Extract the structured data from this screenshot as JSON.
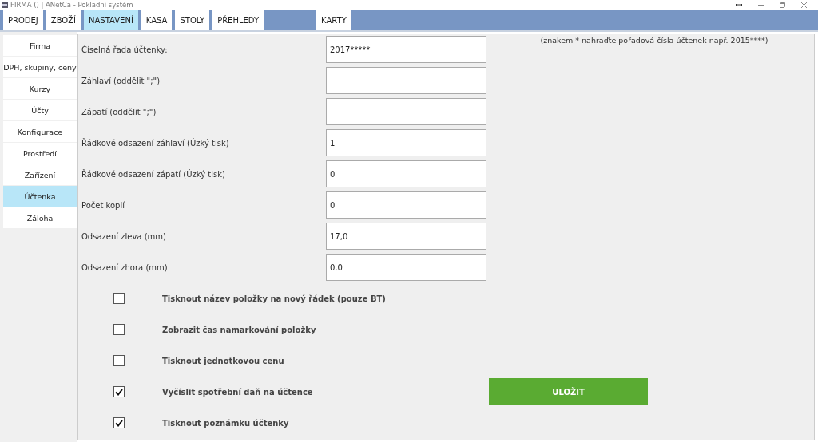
{
  "window": {
    "title": "FIRMA () | ANetCa - Pokladní systém"
  },
  "tabs": [
    {
      "label": "PRODEJ",
      "selected": false
    },
    {
      "label": "ZBOŽÍ",
      "selected": false
    },
    {
      "label": "NASTAVENÍ",
      "selected": true
    },
    {
      "label": "KASA",
      "selected": false
    },
    {
      "label": "STOLY",
      "selected": false
    },
    {
      "label": "PŘEHLEDY",
      "selected": false
    },
    {
      "label": "KARTY",
      "selected": false
    }
  ],
  "sidebar": {
    "items": [
      {
        "label": "Firma",
        "selected": false
      },
      {
        "label": "DPH, skupiny, ceny",
        "selected": false
      },
      {
        "label": "Kurzy",
        "selected": false
      },
      {
        "label": "Účty",
        "selected": false
      },
      {
        "label": "Konfigurace",
        "selected": false
      },
      {
        "label": "Prostředí",
        "selected": false
      },
      {
        "label": "Zařízení",
        "selected": false
      },
      {
        "label": "Účtenka",
        "selected": true
      },
      {
        "label": "Záloha",
        "selected": false
      }
    ]
  },
  "note": "(znakem * nahraďte pořadová čísla účtenek např. 2015****)",
  "fields": [
    {
      "label": "Číselná řada účtenky:",
      "value": "2017*****"
    },
    {
      "label": "Záhlaví (oddělit \";\")"
    },
    {
      "label": "Zápatí (oddělit \";\")"
    },
    {
      "label": "Řádkové odsazení záhlaví (Úzký tisk)",
      "value": "1"
    },
    {
      "label": "Řádkové odsazení zápatí (Úzký tisk)",
      "value": "0"
    },
    {
      "label": "Počet kopií",
      "value": "0"
    },
    {
      "label": "Odsazení zleva (mm)",
      "value": "17,0"
    },
    {
      "label": "Odsazení zhora (mm)",
      "value": "0,0"
    }
  ],
  "options": [
    {
      "label": "Tisknout název položky na nový řádek (pouze BT)",
      "checked": false
    },
    {
      "label": "Zobrazit čas namarkování položky",
      "checked": false
    },
    {
      "label": "Tisknout jednotkovou cenu",
      "checked": false
    },
    {
      "label": "Vyčíslit spotřební daň na účtence",
      "checked": true
    },
    {
      "label": "Tisknout poznámku účtenky",
      "checked": true
    }
  ],
  "save_button": "ULOŽIT"
}
